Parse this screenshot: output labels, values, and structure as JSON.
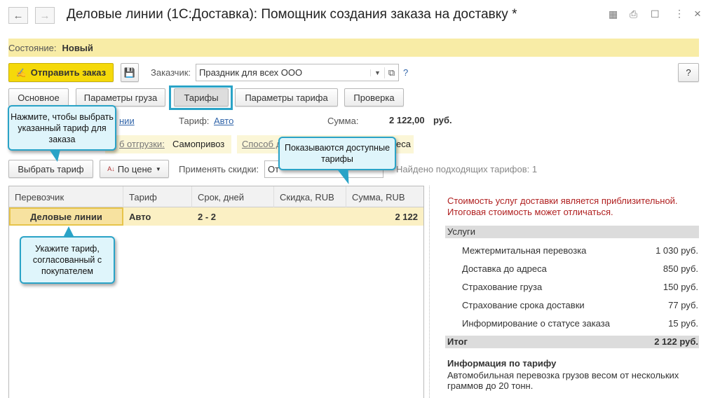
{
  "window": {
    "title": "Деловые линии (1С:Доставка): Помощник создания заказа на доставку *",
    "icons": [
      "back-arrow-icon",
      "forward-arrow-icon",
      "save-icon",
      "print-icon",
      "preview-icon",
      "more-icon",
      "close-icon"
    ]
  },
  "status": {
    "label": "Состояние:",
    "value": "Новый"
  },
  "toolbar": {
    "send_label": "Отправить заказ",
    "customer_label": "Заказчик:",
    "customer_value": "Праздник для всех ООО",
    "help_link": "?",
    "help_button": "?"
  },
  "tabs": [
    {
      "label": "Основное"
    },
    {
      "label": "Параметры груза"
    },
    {
      "label": "Тарифы",
      "active": true
    },
    {
      "label": "Параметры тарифа"
    },
    {
      "label": "Проверка"
    }
  ],
  "info": {
    "carrier_fragment": "нии",
    "tariff_label": "Тариф:",
    "tariff_value": "Авто",
    "sum_label": "Сумма:",
    "sum_value": "2 122,00",
    "sum_unit": "руб.",
    "shipment_label_fragment": "б отгрузки:",
    "shipment_value": "Самопривоз",
    "delivery_label_fragment": "Способ д",
    "delivery_value_fragment": "еса"
  },
  "filters": {
    "select_tariff": "Выбрать тариф",
    "sort_label": "По цене",
    "discount_label": "Применять скидки:",
    "discount_value_fragment": "От",
    "found_text": "Найдено подходящих тарифов: 1"
  },
  "table": {
    "columns": [
      "Перевозчик",
      "Тариф",
      "Срок, дней",
      "Скидка, RUB",
      "Сумма, RUB"
    ],
    "rows": [
      {
        "carrier": "Деловые линии",
        "tariff": "Авто",
        "days": "2 - 2",
        "discount": "",
        "sum": "2 122"
      }
    ]
  },
  "summary": {
    "warning": [
      "Стоимость услуг доставки является приблизительной.",
      "Итоговая стоимость может отличаться."
    ],
    "services_header": "Услуги",
    "services": [
      {
        "name": "Межтермитальная перевозка",
        "price": "1 030 руб."
      },
      {
        "name": "Доставка до адреса",
        "price": "850 руб."
      },
      {
        "name": "Страхование груза",
        "price": "150 руб."
      },
      {
        "name": "Страхование срока доставки",
        "price": "77 руб."
      },
      {
        "name": "Информирование о статусе заказа",
        "price": "15 руб."
      }
    ],
    "total_label": "Итог",
    "total_value": "2 122 руб.",
    "info_title": "Информация по тарифу",
    "info_text": "Автомобильная перевозка грузов весом от нескольких граммов до 20 тонн."
  },
  "callouts": {
    "select": "Нажмите, чтобы выбрать указанный тариф для заказа",
    "available": "Показываются доступные тарифы",
    "agreed": "Укажите тариф, согласованный с покупателем"
  },
  "colors": {
    "status_bar": "#f8eca6",
    "send_button": "#f5d90a",
    "callout_border": "#2aa3c7",
    "warning": "#b02020",
    "selected_row": "#fbf0c4"
  }
}
